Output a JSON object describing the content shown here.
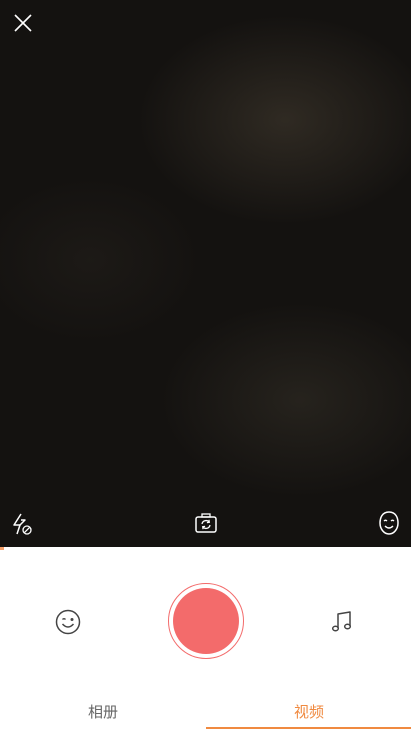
{
  "camera": {
    "close_icon": "close-icon",
    "flash_icon": "flash-off-icon",
    "flip_icon": "camera-flip-icon",
    "face_icon": "face-beauty-icon"
  },
  "recording": {
    "progress_fraction": 0.01,
    "record_button_color": "#f36b6b",
    "progress_color": "#f5a06a"
  },
  "controls": {
    "sticker_icon": "smiley-sticker-icon",
    "music_icon": "music-note-icon"
  },
  "tabs": [
    {
      "label": "相册",
      "active": false
    },
    {
      "label": "视频",
      "active": true
    }
  ],
  "colors": {
    "accent": "#f08a40",
    "inactive_tab": "#666666"
  }
}
